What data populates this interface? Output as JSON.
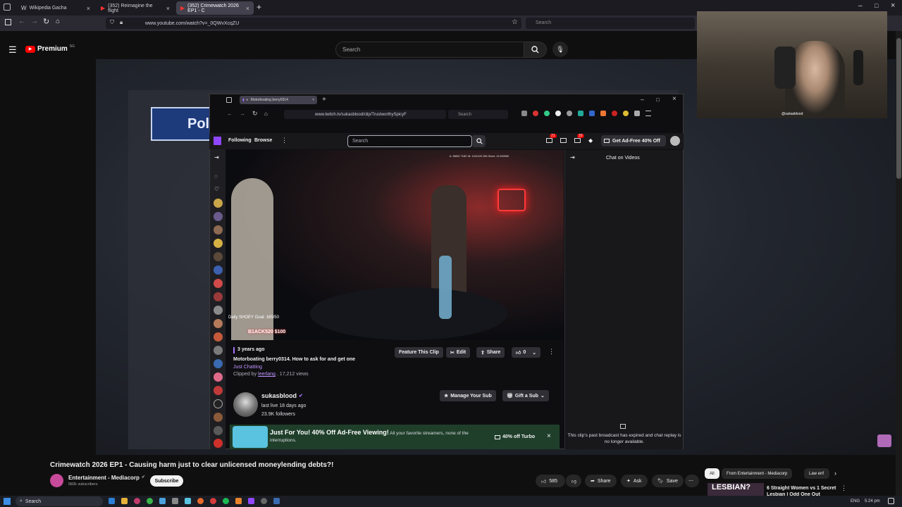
{
  "browser": {
    "tabs": [
      {
        "label": "Wikipedia Gacha"
      },
      {
        "label": "(352) Reimagine the flight"
      },
      {
        "label": "(352) Crimewatch 2026 EP1 - C"
      }
    ],
    "url": "www.youtube.com/watch?v=_0QWvXcqZU",
    "search_placeholder": "Search"
  },
  "youtube": {
    "logo_text": "Premium",
    "logo_badge": "SG",
    "search_placeholder": "Search",
    "video_title": "Crimewatch 2026 EP1 - Causing harm just to clear unlicensed moneylending debts?!",
    "channel_name": "Entertainment - Mediacorp",
    "subscribers": "582k subscribers",
    "subscribe_label": "Subscribe",
    "likes": "585",
    "share_label": "Share",
    "ask_label": "Ask",
    "save_label": "Save",
    "chips": [
      "All",
      "From Entertainment - Mediacorp",
      "Law enf"
    ],
    "rec_thumb_text": "LESBIAN?",
    "rec_title": "6 Straight Women vs 1 Secret",
    "rec_title2": "Lesbian | Odd One Out"
  },
  "background": {
    "sign_text": "Pol"
  },
  "inner_browser": {
    "tab_label": "Motorboating berry0314",
    "url": "www.twitch.tv/sukasblood/clip/TrustworthySpicyF",
    "search_placeholder": "Search"
  },
  "twitch": {
    "nav_following": "Following",
    "nav_browse": "Browse",
    "search_placeholder": "Search",
    "badge_notifications": "21",
    "badge_whispers": "33",
    "ad_free_label": "Get Ad-Free 40% Off",
    "chat_header": "Chat on Videos",
    "clip_age": "3 years ago",
    "clip_title": "Motorboating berry0314. How to ask for and get one",
    "category": "Just Chatting",
    "clipped_by_prefix": "Clipped by",
    "clipped_by_user": "leerlang",
    "views": ". 17,212 views",
    "feature_clip": "Feature This Clip",
    "edit": "Edit",
    "share": "Share",
    "likes": "0",
    "channel": "sukasblood",
    "last_live": "last live 18 days ago",
    "followers": "23.9K followers",
    "manage_sub": "Manage Your Sub",
    "gift_sub": "Gift a Sub",
    "promo_title": "Just For You! 40% Off Ad-Free Viewing!",
    "promo_body": "All your favorite streamers, none of the interruptions.",
    "promo_button": "40% off Turbo",
    "chat_notice": "This clip's past broadcast has expired and chat replay is no longer available.",
    "overlay_goal": "Daily SHOEY Goal: 165/50",
    "overlay_donation": "B1ACK520 $100",
    "overlay_stats": "b: 5800/ 7182 rtt: 124/125 156 Seen: 11:53/968"
  },
  "webcam": {
    "handle": "@sukasblood"
  },
  "taskbar": {
    "search_placeholder": "Search",
    "lang": "ENG",
    "time": "5:24 pm"
  }
}
